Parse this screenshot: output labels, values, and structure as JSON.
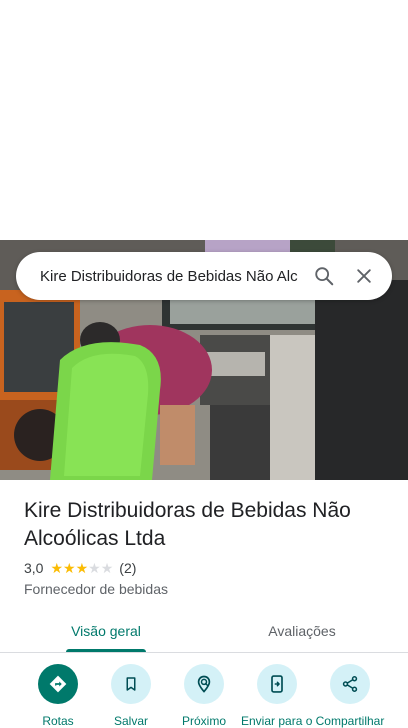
{
  "search": {
    "query": "Kire Distribuidoras de Bebidas Não Alcoólicas Ltda"
  },
  "place": {
    "name": "Kire Distribuidoras de Bebidas Não Alcoólicas Ltda",
    "rating_text": "3,0",
    "rating_value": 3,
    "rating_max": 5,
    "review_count": "(2)",
    "category": "Fornecedor de bebidas"
  },
  "tabs": [
    {
      "label": "Visão geral",
      "selected": true
    },
    {
      "label": "Avaliações",
      "selected": false
    }
  ],
  "actions": [
    {
      "label": "Rotas",
      "icon": "directions-icon"
    },
    {
      "label": "Salvar",
      "icon": "bookmark-icon"
    },
    {
      "label": "Próximo",
      "icon": "nearby-icon"
    },
    {
      "label": "Enviar para o smartphone",
      "icon": "send-to-phone-icon"
    },
    {
      "label": "Compartilhar",
      "icon": "share-icon"
    }
  ],
  "colors": {
    "accent": "#00796b",
    "star": "#fbbc04",
    "action_bg": "#d4f1f7"
  }
}
